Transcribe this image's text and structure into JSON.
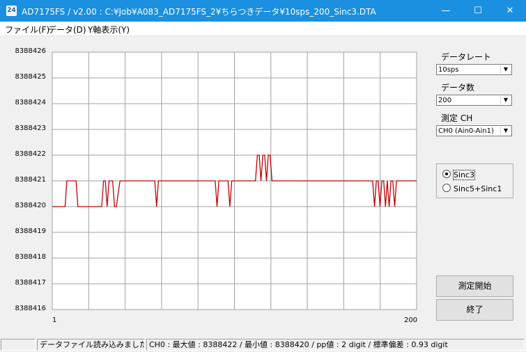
{
  "window": {
    "icon_text": "24",
    "title": "AD7175FS / v2.00 : C:¥Job¥A083_AD7175FS_2¥ちらつきデータ¥10sps_200_Sinc3.DTA",
    "minimize": "—",
    "maximize": "☐",
    "close": "✕"
  },
  "menu": {
    "items": [
      "ファイル(F)",
      "データ(D)",
      "Y軸表示(Y)"
    ]
  },
  "chart_data": {
    "type": "line",
    "xlim": [
      1,
      200
    ],
    "ylim": [
      8388416,
      8388426
    ],
    "x_tick_labels": [
      "1",
      "200"
    ],
    "y_tick_labels": [
      "8388426",
      "8388425",
      "8388424",
      "8388423",
      "8388422",
      "8388421",
      "8388420",
      "8388419",
      "8388418",
      "8388417",
      "8388416"
    ],
    "grid": true,
    "line_color": "#c00000",
    "series": [
      {
        "x": [
          1,
          8,
          9,
          14,
          15,
          28,
          29,
          30,
          31,
          32,
          34,
          35,
          36,
          38,
          39,
          40,
          57,
          58,
          59,
          60,
          90,
          91,
          92,
          93,
          94,
          97,
          98,
          99,
          100,
          112,
          113,
          114,
          115,
          116,
          117,
          118,
          119,
          120,
          121,
          122,
          123,
          176,
          177,
          178,
          179,
          180,
          181,
          182,
          183,
          184,
          185,
          186,
          187,
          188,
          189,
          200
        ],
        "values": [
          8388420,
          8388420,
          8388421,
          8388421,
          8388420,
          8388420,
          8388421,
          8388421,
          8388420,
          8388421,
          8388421,
          8388420,
          8388420,
          8388421,
          8388421,
          8388421,
          8388421,
          8388420,
          8388421,
          8388421,
          8388421,
          8388420,
          8388421,
          8388421,
          8388421,
          8388421,
          8388420,
          8388421,
          8388421,
          8388421,
          8388422,
          8388422,
          8388421,
          8388422,
          8388422,
          8388421,
          8388422,
          8388422,
          8388421,
          8388421,
          8388421,
          8388421,
          8388420,
          8388421,
          8388421,
          8388420,
          8388421,
          8388421,
          8388420,
          8388421,
          8388420,
          8388421,
          8388421,
          8388420,
          8388421,
          8388421
        ]
      }
    ]
  },
  "panel": {
    "rate_label": "データレート",
    "rate_value": "10sps",
    "count_label": "データ数",
    "count_value": "200",
    "ch_label": "測定 CH",
    "ch_value": "CH0 (Ain0-Ain1)",
    "filter_options": [
      "Sinc3",
      "Sinc5+Sinc1"
    ],
    "filter_selected": 0,
    "start_button": "測定開始",
    "exit_button": "終了"
  },
  "status": {
    "cell1": "",
    "cell2": "データファイル読み込みました",
    "cell3": "CH0 : 最大値 : 8388422 / 最小値 : 8388420 / pp値 : 2 digit / 標準偏差 : 0.93 digit"
  }
}
